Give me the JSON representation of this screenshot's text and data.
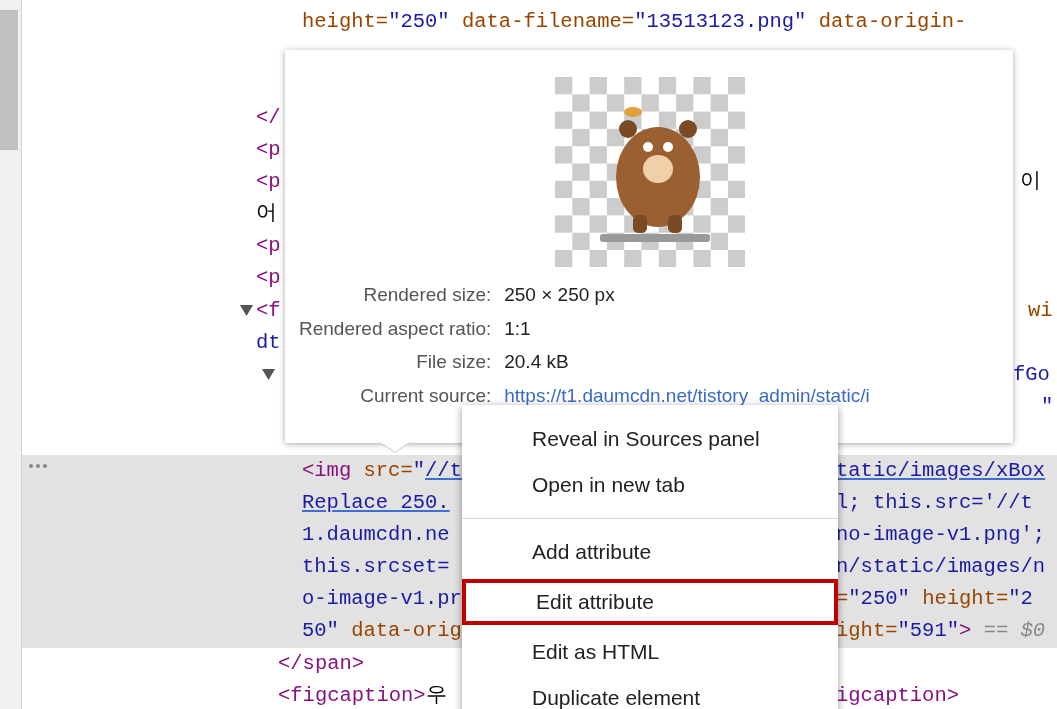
{
  "code_lines": [
    {
      "selected": false,
      "left": [
        {
          "kind": "attr",
          "text": "height="
        },
        {
          "kind": "value",
          "text": "\"250\""
        },
        {
          "kind": "attr",
          "text": " data-filename="
        },
        {
          "kind": "value",
          "text": "\"13513123.png\""
        },
        {
          "kind": "attr",
          "text": " data-origin-"
        }
      ]
    },
    {
      "selected": false
    },
    {
      "selected": false
    },
    {
      "selected": false,
      "left": [
        {
          "kind": "tag",
          "text": "</"
        }
      ]
    },
    {
      "selected": false,
      "left": [
        {
          "kind": "tag",
          "text": "<p"
        }
      ]
    },
    {
      "selected": false,
      "left": [
        {
          "kind": "tag",
          "text": "<p"
        }
      ],
      "right": [
        {
          "kind": "text",
          "text": "이"
        }
      ]
    },
    {
      "selected": false,
      "left": [
        {
          "kind": "text",
          "text": "어"
        }
      ]
    },
    {
      "selected": false,
      "left": [
        {
          "kind": "tag",
          "text": "<p"
        }
      ]
    },
    {
      "selected": false,
      "left": [
        {
          "kind": "tag",
          "text": "<p"
        }
      ]
    },
    {
      "selected": false,
      "expanded": true,
      "left": [
        {
          "kind": "tag",
          "text": "<f"
        }
      ],
      "right": [
        {
          "kind": "attr",
          "text": "wi"
        }
      ]
    },
    {
      "selected": false,
      "left": [
        {
          "kind": "value",
          "text": "dt"
        }
      ]
    },
    {
      "selected": false,
      "expanded": true,
      "right": [
        {
          "kind": "value",
          "text": "fGo"
        }
      ]
    },
    {
      "selected": false,
      "right": [
        {
          "kind": "value",
          "text": "\""
        }
      ]
    },
    {
      "selected": false
    },
    {
      "selected": true,
      "left": [
        {
          "kind": "tag",
          "text": "<img"
        },
        {
          "kind": "attr",
          "text": " src="
        },
        {
          "kind": "value",
          "text": "\""
        },
        {
          "kind": "link",
          "text": "//t"
        }
      ],
      "right": [
        {
          "kind": "link",
          "text": "tatic/images/xBox"
        }
      ]
    },
    {
      "selected": true,
      "left": [
        {
          "kind": "link",
          "text": "Replace 250."
        }
      ],
      "right": [
        {
          "kind": "value",
          "text": "l; this.src='//t"
        }
      ]
    },
    {
      "selected": true,
      "left": [
        {
          "kind": "value",
          "text": "1.daumcdn.ne"
        }
      ],
      "right": [
        {
          "kind": "value",
          "text": "no-image-v1.png';"
        }
      ]
    },
    {
      "selected": true,
      "left": [
        {
          "kind": "value",
          "text": "this.srcset="
        }
      ],
      "right": [
        {
          "kind": "value",
          "text": "n/static/images/n"
        }
      ]
    },
    {
      "selected": true,
      "left": [
        {
          "kind": "value",
          "text": "o-image-v1.pr"
        }
      ],
      "right": [
        {
          "kind": "attr",
          "text": "="
        },
        {
          "kind": "value",
          "text": "\"250\""
        },
        {
          "kind": "attr",
          "text": " height="
        },
        {
          "kind": "value",
          "text": "\"2"
        }
      ]
    },
    {
      "selected": true,
      "left": [
        {
          "kind": "value",
          "text": "50\""
        },
        {
          "kind": "attr",
          "text": " data-orig"
        }
      ],
      "right": [
        {
          "kind": "attr",
          "text": "ight="
        },
        {
          "kind": "value",
          "text": "\"591\""
        },
        {
          "kind": "tag",
          "text": ">"
        },
        {
          "kind": "hint",
          "text": " == $0"
        }
      ]
    },
    {
      "selected": false,
      "left": [
        {
          "kind": "tag",
          "text": "</span>"
        }
      ]
    },
    {
      "selected": false,
      "left": [
        {
          "kind": "tag",
          "text": "<figcaption>"
        },
        {
          "kind": "text",
          "text": "우"
        }
      ],
      "right": [
        {
          "kind": "tag",
          "text": "igcaption>"
        }
      ]
    }
  ],
  "image_popover": {
    "rows": [
      {
        "label": "Rendered size:",
        "value": "250 × 250 px"
      },
      {
        "label": "Rendered aspect ratio:",
        "value": "1:1"
      },
      {
        "label": "File size:",
        "value": "20.4 kB"
      },
      {
        "label": "Current source:",
        "value": "https://t1.daumcdn.net/tistory_admin/static/i",
        "kind": "link"
      }
    ]
  },
  "context_menu": {
    "items": [
      {
        "label": "Reveal in Sources panel",
        "annotated": false
      },
      {
        "label": "Open in new tab",
        "annotated": false
      },
      {
        "kind": "separator"
      },
      {
        "label": "Add attribute",
        "annotated": false
      },
      {
        "label": "Edit attribute",
        "annotated": true
      },
      {
        "label": "Edit as HTML",
        "annotated": false
      },
      {
        "label": "Duplicate element",
        "annotated": false
      }
    ]
  }
}
